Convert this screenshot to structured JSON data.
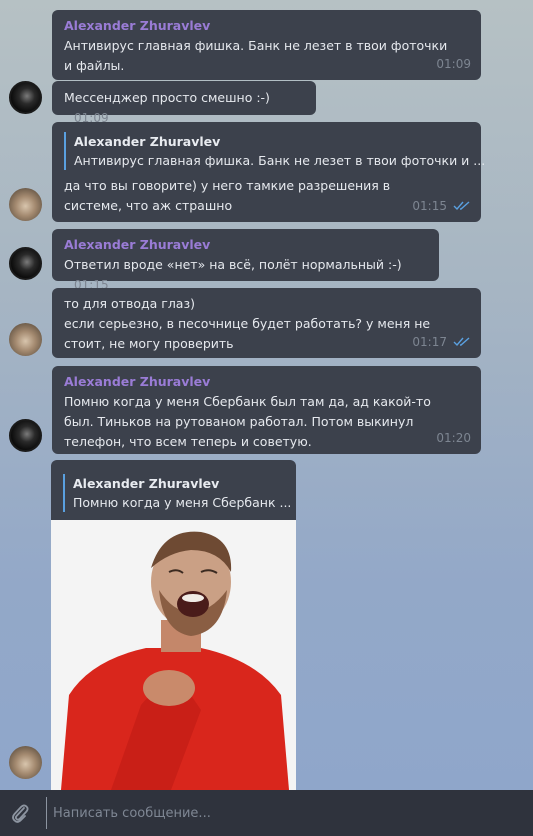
{
  "colors": {
    "bubble": "#3c414c",
    "sender": "#9a7cd6",
    "time": "#7d8591",
    "check": "#5aa0e0",
    "composer": "#2f333d"
  },
  "messages": [
    {
      "sender": "Alexander Zhuravlev",
      "text": "Антивирус главная фишка. Банк не лезет в твои фоточки и файлы.",
      "time": "01:09"
    },
    {
      "text": "Мессенджер просто смешно :-)",
      "time": "01:09"
    },
    {
      "quote_name": "Alexander Zhuravlev",
      "quote_text": "Антивирус главная фишка. Банк не лезет в твои фоточки и ...",
      "text": "да что вы говорите) у него тамкие разрешения в системе, что аж страшно",
      "time": "01:15",
      "read_icon": "double-check-icon"
    },
    {
      "sender": "Alexander Zhuravlev",
      "text": "Ответил вроде «нет» на всё, полёт нормальный :-)",
      "time": "01:15"
    },
    {
      "text": "то для отвода глаз)\nесли серьезно, в песочнице будет работать? у меня не стоит, не могу проверить",
      "line1": "то для отвода глаз)",
      "line2": "если серьезно, в песочнице будет работать? у меня не стоит, не могу проверить",
      "time": "01:17",
      "read_icon": "double-check-icon"
    },
    {
      "sender": "Alexander Zhuravlev",
      "text": "Помню когда у меня Сбербанк был там да, ад какой-то был. Тиньков на рутованом работал. Потом выкинул телефон, что всем теперь и советую.",
      "time": "01:20"
    },
    {
      "quote_name": "Alexander Zhuravlev",
      "quote_text": "Помню когда у меня Сбербанк ...",
      "media": "gif-laughing-man"
    }
  ],
  "composer": {
    "placeholder": "Написать сообщение...",
    "attach_icon": "paperclip-icon"
  }
}
